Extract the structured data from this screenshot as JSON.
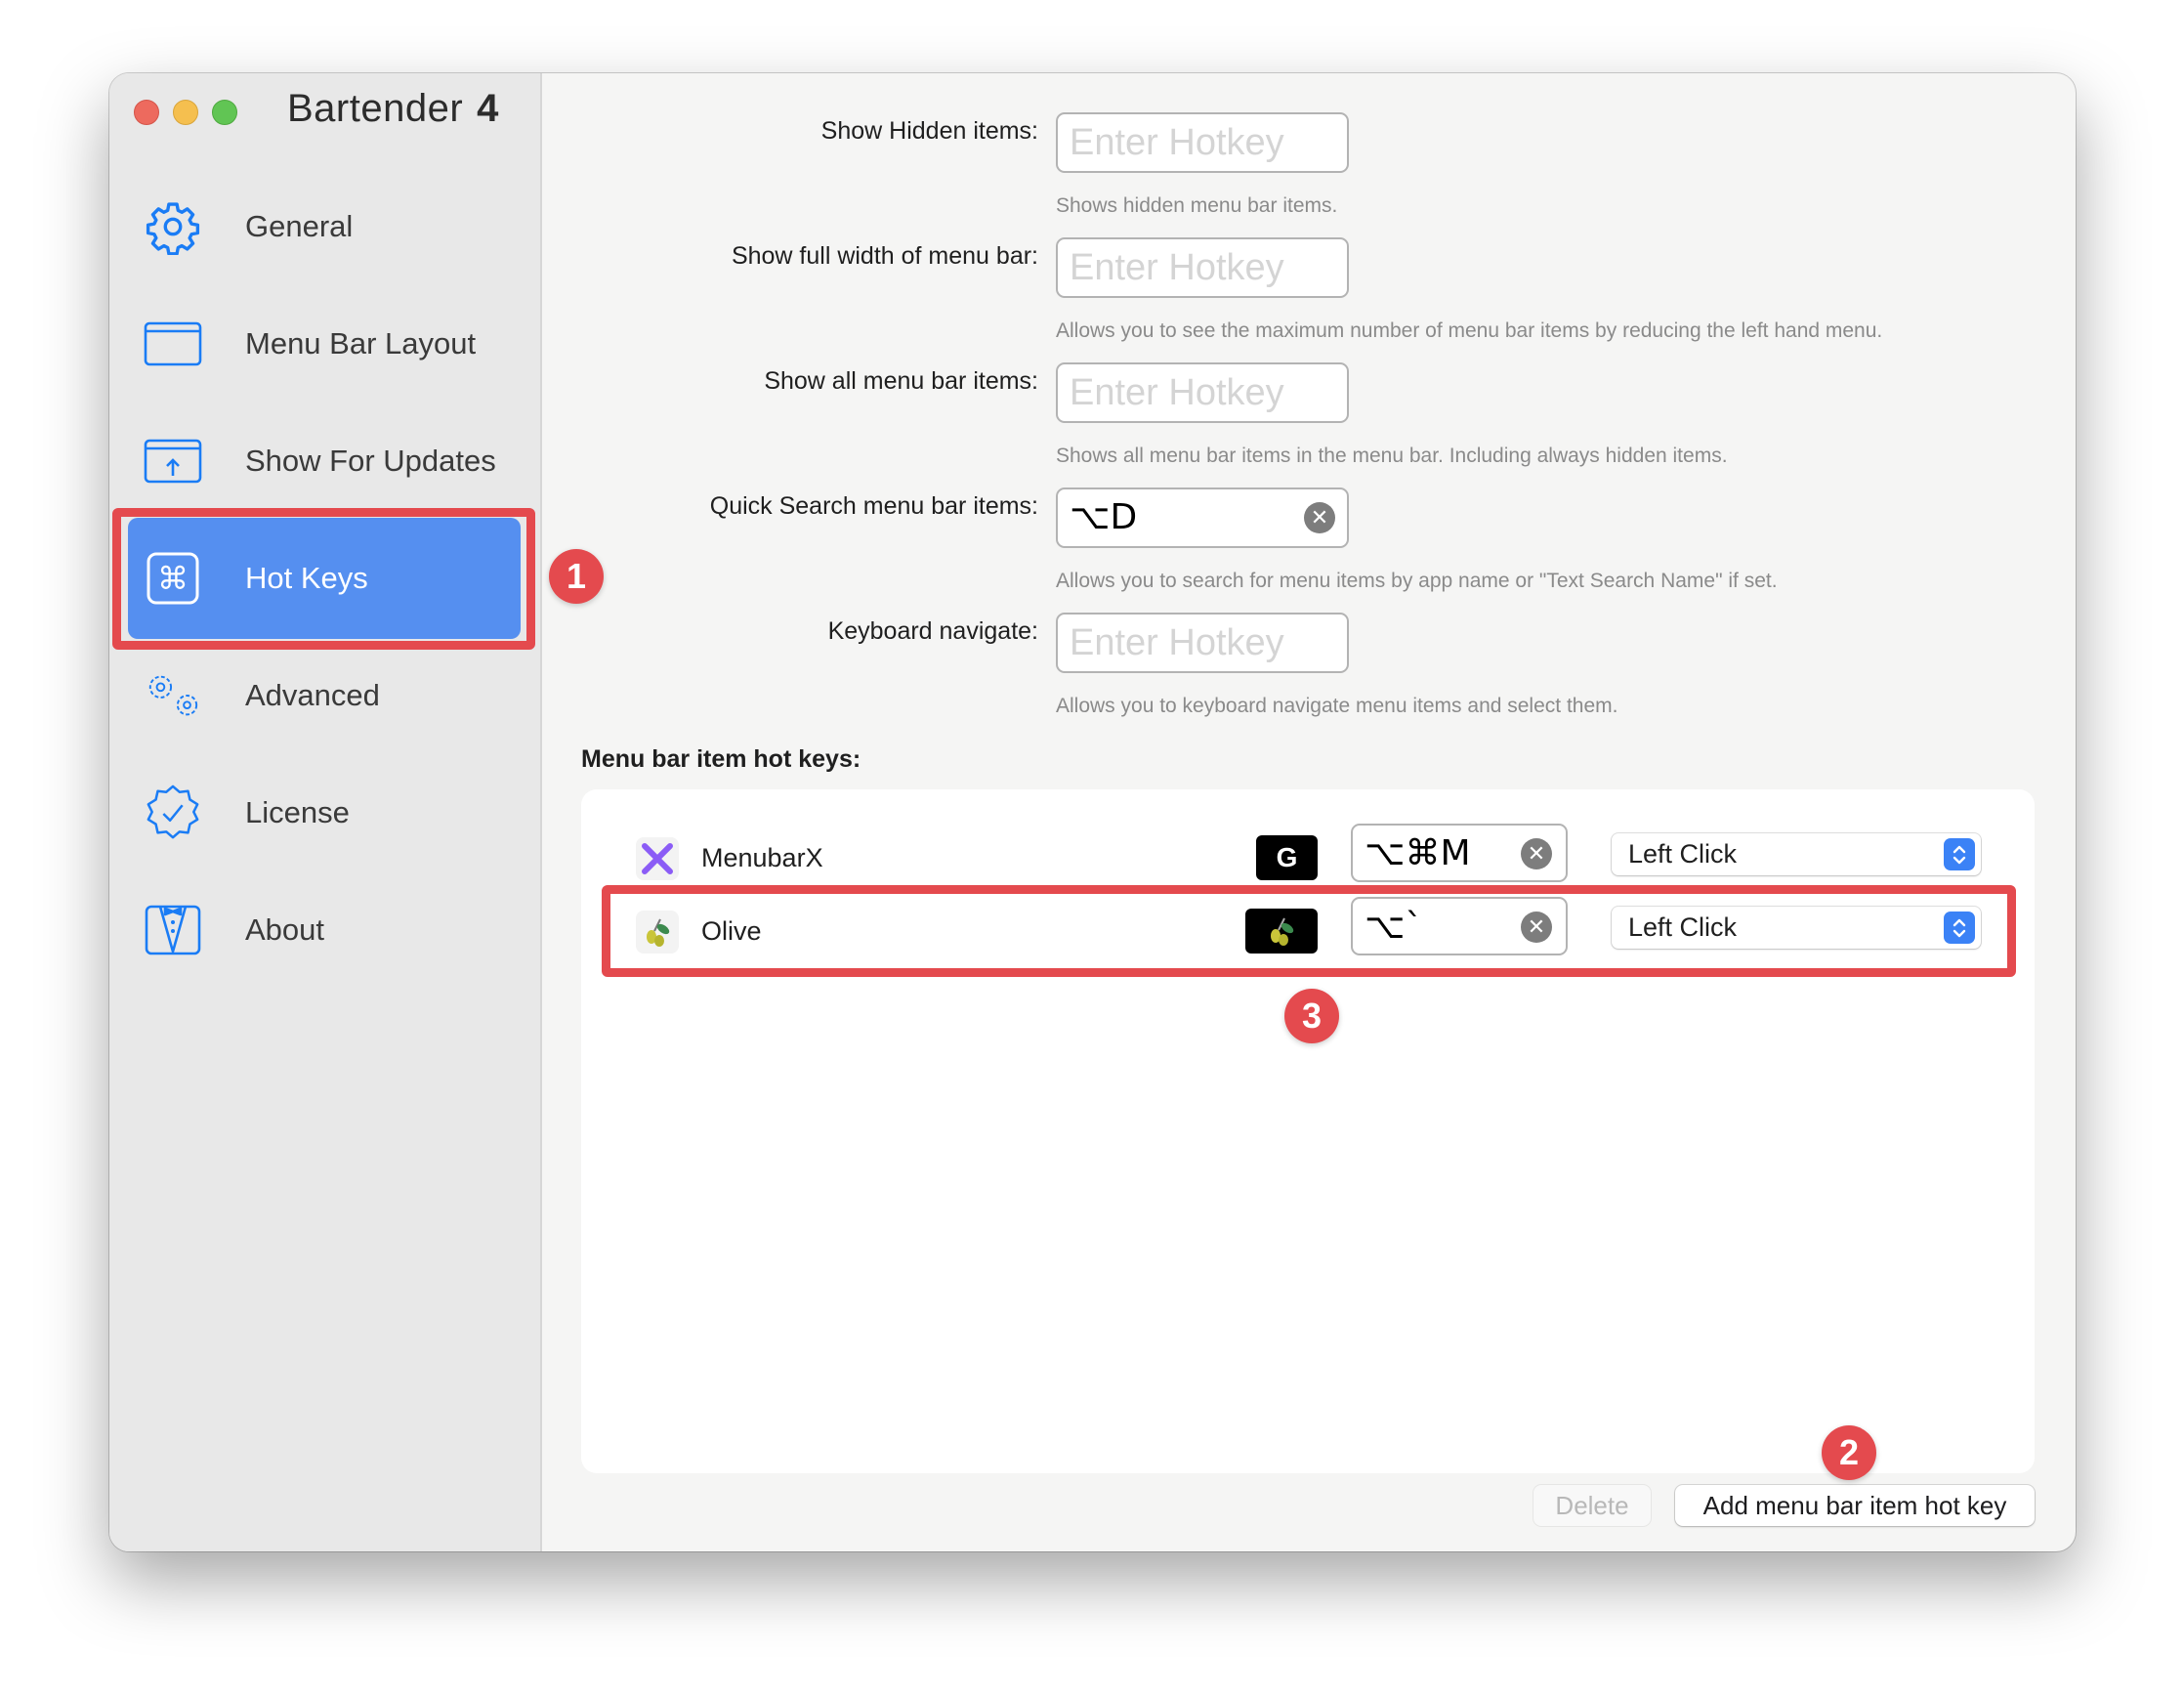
{
  "window": {
    "title": "Bartender",
    "version": "4"
  },
  "sidebar": {
    "items": [
      {
        "label": "General",
        "icon": "gear-icon"
      },
      {
        "label": "Menu Bar Layout",
        "icon": "window-icon"
      },
      {
        "label": "Show For Updates",
        "icon": "window-arrow-up-icon"
      },
      {
        "label": "Hot Keys",
        "icon": "command-key-icon",
        "active": true
      },
      {
        "label": "Advanced",
        "icon": "gears-icon"
      },
      {
        "label": "License",
        "icon": "checkmark-seal-icon"
      },
      {
        "label": "About",
        "icon": "tuxedo-icon"
      }
    ]
  },
  "hotkeys": [
    {
      "label": "Show Hidden items:",
      "value": "",
      "placeholder": "Enter Hotkey",
      "help": "Shows hidden menu bar items."
    },
    {
      "label": "Show full width of menu bar:",
      "value": "",
      "placeholder": "Enter Hotkey",
      "help": "Allows you to see the maximum number of menu bar items by reducing the left hand menu."
    },
    {
      "label": "Show all menu bar items:",
      "value": "",
      "placeholder": "Enter Hotkey",
      "help": "Shows all menu bar items in the menu bar. Including always hidden items."
    },
    {
      "label": "Quick Search menu bar items:",
      "value": "⌥D",
      "placeholder": "Enter Hotkey",
      "help": "Allows you to search for menu items by app name or \"Text Search Name\" if set."
    },
    {
      "label": "Keyboard navigate:",
      "value": "",
      "placeholder": "Enter Hotkey",
      "help": "Allows you to keyboard navigate menu items and select them."
    }
  ],
  "item_hotkeys": {
    "title": "Menu bar item hot keys:",
    "rows": [
      {
        "app": "MenubarX",
        "menubar_icon": "G",
        "hotkey": "⌥⌘M",
        "action": "Left Click"
      },
      {
        "app": "Olive",
        "menubar_icon": "olive-icon",
        "hotkey": "⌥`",
        "action": "Left Click"
      }
    ],
    "delete_label": "Delete",
    "add_label": "Add menu bar item hot key"
  },
  "annotations": {
    "badge1": "1",
    "badge2": "2",
    "badge3": "3",
    "color": "#e44a4e"
  },
  "colors": {
    "accent": "#558ff0",
    "icon_blue": "#1a7cf5"
  }
}
